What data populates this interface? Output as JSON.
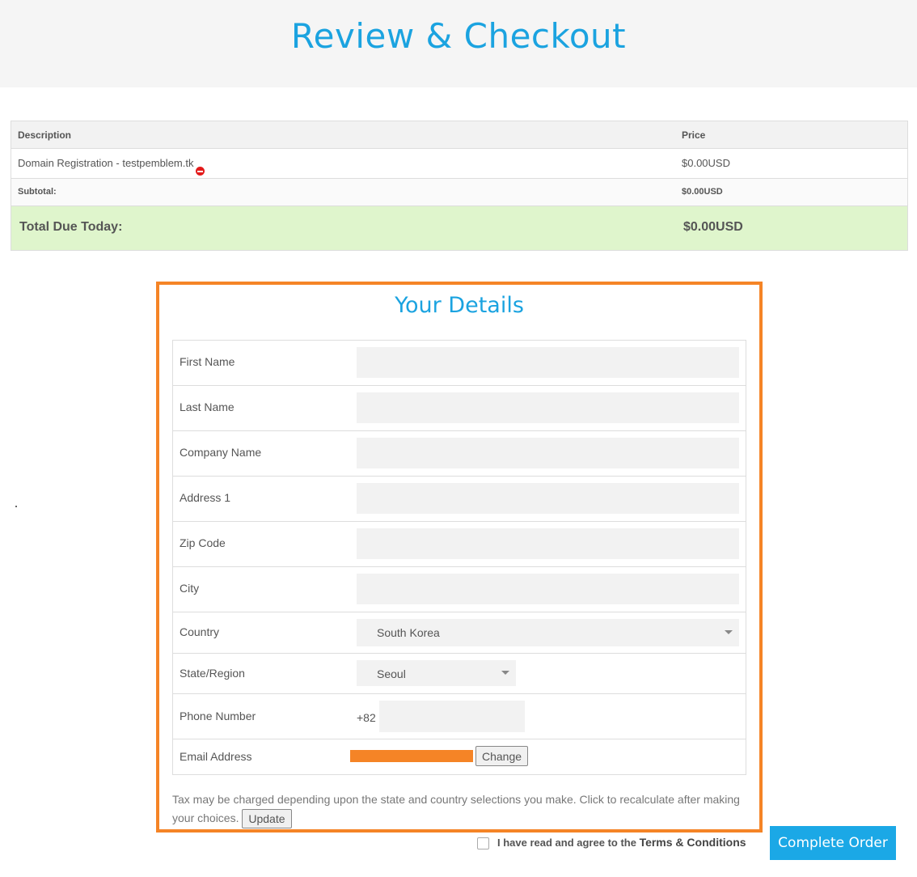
{
  "page": {
    "title": "Review & Checkout"
  },
  "cart": {
    "headers": {
      "description": "Description",
      "price": "Price"
    },
    "item": {
      "description": "Domain Registration - testpemblem.tk",
      "price": "$0.00USD"
    },
    "subtotal": {
      "label": "Subtotal:",
      "value": "$0.00USD"
    },
    "total": {
      "label": "Total Due Today:",
      "value": "$0.00USD"
    }
  },
  "details": {
    "title": "Your Details",
    "first_name": {
      "label": "First Name",
      "value": ""
    },
    "last_name": {
      "label": "Last Name",
      "value": ""
    },
    "company_name": {
      "label": "Company Name",
      "value": ""
    },
    "address1": {
      "label": "Address 1",
      "value": ""
    },
    "zip_code": {
      "label": "Zip Code",
      "value": ""
    },
    "city": {
      "label": "City",
      "value": ""
    },
    "country": {
      "label": "Country",
      "value": "South Korea"
    },
    "state": {
      "label": "State/Region",
      "value": "Seoul"
    },
    "phone": {
      "label": "Phone Number",
      "prefix": "+82",
      "value": ""
    },
    "email": {
      "label": "Email Address",
      "change_label": "Change"
    },
    "tax_note": "Tax may be charged depending upon the state and country selections you make. Click to recalculate after making your choices.",
    "update_label": "Update"
  },
  "footer": {
    "agree_text": "I have read and agree to the ",
    "terms_link": "Terms & Conditions",
    "complete_order_label": "Complete Order"
  },
  "colors": {
    "accent": "#1ba3e0",
    "highlight_border": "#f58426",
    "total_bg": "#dff5cc",
    "remove_icon": "#e31b1b"
  }
}
